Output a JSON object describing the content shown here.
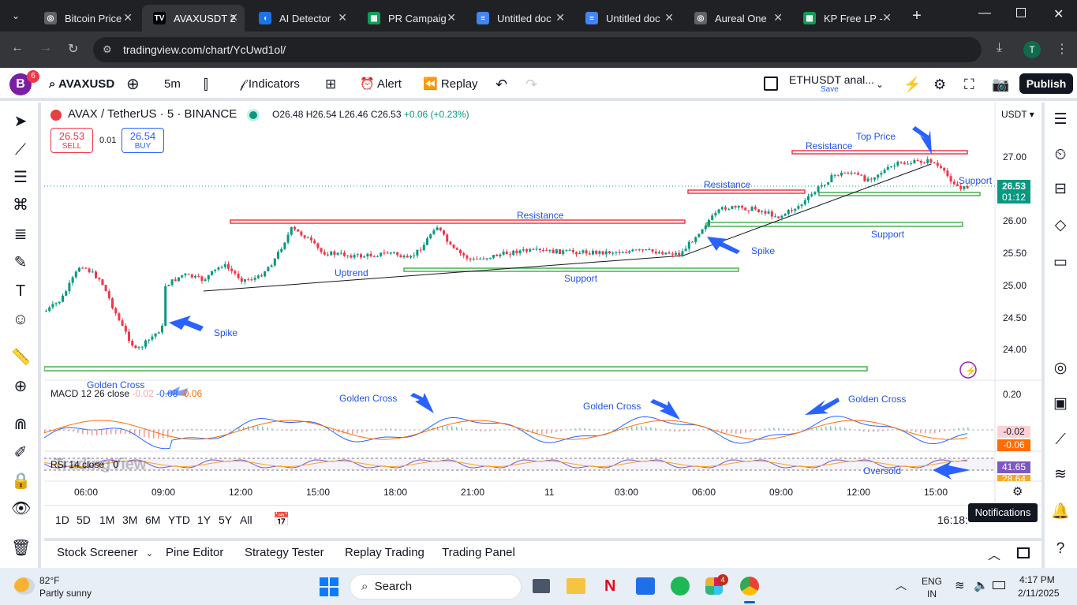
{
  "browser": {
    "tabs": [
      {
        "title": "Bitcoin Price",
        "favicon": "tv-icon",
        "color": "#c4c7c5"
      },
      {
        "title": "AVAXUSDT 2",
        "favicon": "tv-icon",
        "color": "#ffffff"
      },
      {
        "title": "AI Detector",
        "favicon": "ai-icon",
        "color": "#1a73e8"
      },
      {
        "title": "PR Campaig",
        "favicon": "sheets-icon",
        "color": "#0f9d58"
      },
      {
        "title": "Untitled doc",
        "favicon": "docs-icon",
        "color": "#4285f4"
      },
      {
        "title": "Untitled doc",
        "favicon": "docs-icon",
        "color": "#4285f4"
      },
      {
        "title": "Aureal One",
        "favicon": "ai-icon",
        "color": "#c4c7c5"
      },
      {
        "title": "KP Free LP -",
        "favicon": "sheets-icon",
        "color": "#0f9d58"
      }
    ],
    "url": "tradingview.com/chart/YcUwd1ol/",
    "profile_initial": "T"
  },
  "toolbar": {
    "logo_initial": "B",
    "logo_badge": "6",
    "symbol": "AVAXUSD",
    "interval": "5m",
    "indicators": "Indicators",
    "alert": "Alert",
    "replay": "Replay",
    "layout_name": "ETHUSDT anal...",
    "layout_save": "Save",
    "publish": "Publish"
  },
  "legend": {
    "title": "AVAX / TetherUS · 5 · BINANCE",
    "open": "O26.48",
    "high": "H26.54",
    "low": "L26.46",
    "close": "C26.53",
    "change": "+0.06 (+0.23%)",
    "sell_price": "26.53",
    "sell_label": "SELL",
    "spread": "0.01",
    "buy_price": "26.54",
    "buy_label": "BUY",
    "currency": "USDT"
  },
  "price_axis": {
    "ticks": [
      "27.00",
      "26.00",
      "25.50",
      "25.00",
      "24.50",
      "24.00"
    ],
    "current_price": "26.53",
    "countdown": "01:12"
  },
  "time_axis": [
    "06:00",
    "09:00",
    "12:00",
    "15:00",
    "18:00",
    "21:00",
    "11",
    "03:00",
    "06:00",
    "09:00",
    "12:00",
    "15:00"
  ],
  "annotations": {
    "resistance_1": "Resistance",
    "resistance_2": "Resistance",
    "resistance_3": "Resistance",
    "top_price": "Top Price",
    "support_1": "Support",
    "support_2": "Support",
    "support_3": "Support",
    "uptrend": "Uptrend",
    "spike_1": "Spike",
    "spike_2": "Spike",
    "golden_cross_1": "Golden Cross",
    "golden_cross_2": "Golden Cross",
    "golden_cross_3": "Golden Cross",
    "golden_cross_4": "Golden Cross",
    "oversold": "Oversold"
  },
  "macd": {
    "label": "MACD 12 26 close",
    "v1": "-0.02",
    "v2": "-0.08",
    "v3": "-0.06",
    "axis_top": "0.20",
    "badge1": "-0.02",
    "badge2": "-0.06"
  },
  "rsi": {
    "label": "RSI 14 close",
    "value": "0",
    "badge1": "41.65",
    "badge2": "28.64",
    "watermark": "TradingView"
  },
  "ranges": [
    "1D",
    "5D",
    "1M",
    "3M",
    "6M",
    "YTD",
    "1Y",
    "5Y",
    "All"
  ],
  "clock": "16:18:",
  "tooltip": "Notifications",
  "panels": [
    "Stock Screener",
    "Pine Editor",
    "Strategy Tester",
    "Replay Trading",
    "Trading Panel"
  ],
  "taskbar": {
    "temp": "82°F",
    "weather": "Partly sunny",
    "search": "Search",
    "lang1": "ENG",
    "lang2": "IN",
    "time": "4:17 PM",
    "date": "2/11/2025",
    "chrome_badge": "4"
  },
  "colors": {
    "resistance": "#f23645",
    "support": "#4caf50",
    "up": "#089981",
    "down": "#f23645",
    "arrow": "#2962ff",
    "macd": "#2962ff",
    "signal": "#ff6d00"
  }
}
